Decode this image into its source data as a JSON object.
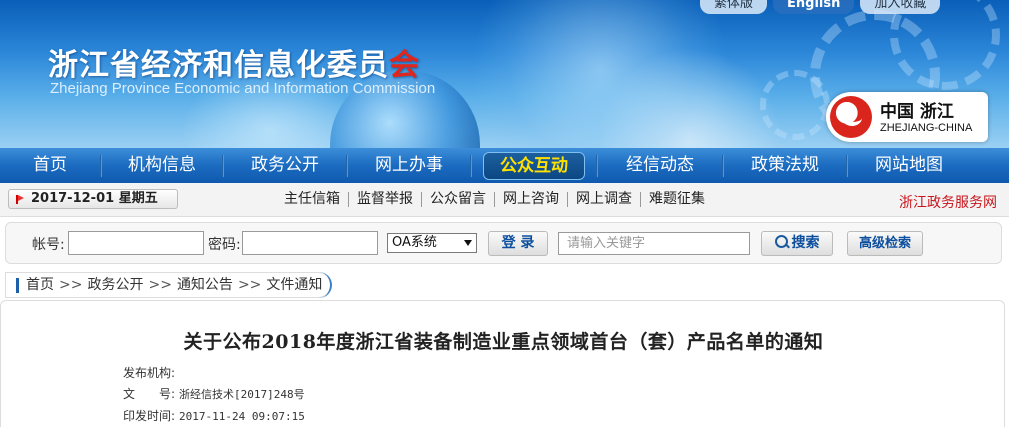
{
  "header": {
    "top_links": [
      "繁体版",
      "English",
      "加入收藏"
    ],
    "title_main": "浙江省经济和信息化委员",
    "title_last": "会",
    "subtitle": "Zhejiang Province Economic and Information Commission",
    "logo_cn": "中国 浙江",
    "logo_en": "ZHEJIANG-CHINA"
  },
  "nav": {
    "items": [
      "首页",
      "机构信息",
      "政务公开",
      "网上办事",
      "公众互动",
      "经信动态",
      "政策法规",
      "网站地图"
    ],
    "active": "公众互动"
  },
  "infobar": {
    "date": "2017-12-01",
    "weekday": "星期五",
    "quick_links": [
      "主任信箱",
      "监督举报",
      "公众留言",
      "网上咨询",
      "网上调查",
      "难题征集"
    ],
    "service_link": "浙江政务服务网"
  },
  "login": {
    "account_label": "帐号:",
    "password_label": "密码:",
    "system_select": "OA系统",
    "login_button": "登 录",
    "search_placeholder": "请输入关键字",
    "search_button": "搜索",
    "advanced_button": "高级检索"
  },
  "breadcrumb": [
    "首页",
    "政务公开",
    "通知公告",
    "文件通知"
  ],
  "breadcrumb_sep": ">>",
  "article": {
    "title": "关于公布2018年度浙江省装备制造业重点领域首台（套）产品名单的通知",
    "publisher_label": "发布机构:",
    "publisher_value": "",
    "docno_label": "文　　号:",
    "docno_value": "浙经信技术[2017]248号",
    "date_label": "印发时间:",
    "date_value": "2017-11-24 09:07:15"
  }
}
